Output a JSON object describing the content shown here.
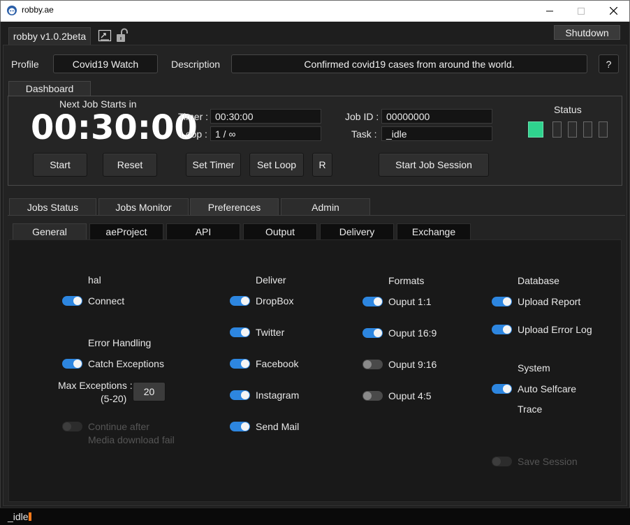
{
  "window": {
    "title": "robby.ae",
    "controls": [
      "minimize",
      "maximize",
      "close"
    ]
  },
  "header": {
    "version_tab": "robby v1.0.2beta",
    "shutdown_label": "Shutdown"
  },
  "profile": {
    "profile_label": "Profile",
    "profile_value": "Covid19 Watch",
    "description_label": "Description",
    "description_value": "Confirmed covid19 cases from around the world.",
    "help_label": "?"
  },
  "dashboard": {
    "tab_label": "Dashboard",
    "next_job_label": "Next Job Starts in",
    "countdown": "00:30:00",
    "timer_label": "Timer :",
    "timer_value": "00:30:00",
    "loop_label": "Loop :",
    "loop_value": "1 / ∞",
    "job_id_label": "Job ID :",
    "job_id_value": "00000000",
    "task_label": "Task  :",
    "task_value": "_idle",
    "status_label": "Status",
    "status_leds": [
      "active",
      "inactive",
      "inactive",
      "inactive",
      "inactive"
    ],
    "status_active_color": "#2fd38e",
    "buttons": {
      "start": "Start",
      "reset": "Reset",
      "set_timer": "Set Timer",
      "set_loop": "Set Loop",
      "r": "R",
      "start_session": "Start Job Session"
    }
  },
  "main_tabs": [
    {
      "label": "Jobs Status",
      "active": false
    },
    {
      "label": "Jobs Monitor",
      "active": false
    },
    {
      "label": "Preferences",
      "active": true
    },
    {
      "label": "Admin",
      "active": false
    }
  ],
  "sub_tabs": [
    {
      "label": "General",
      "active": true
    },
    {
      "label": "aeProject",
      "active": false
    },
    {
      "label": "API",
      "active": false
    },
    {
      "label": "Output",
      "active": false
    },
    {
      "label": "Delivery",
      "active": false
    },
    {
      "label": "Exchange",
      "active": false
    }
  ],
  "general": {
    "hal": {
      "heading": "hal",
      "connect": {
        "label": "Connect",
        "on": true
      }
    },
    "error_handling": {
      "heading": "Error Handling",
      "catch_exceptions": {
        "label": "Catch Exceptions",
        "on": true
      },
      "max_exceptions_label": "Max Exceptions :",
      "max_exceptions_range": "(5-20)",
      "max_exceptions_value": "20",
      "continue_after": {
        "label_line1": "Continue after",
        "label_line2": "Media download fail",
        "on": false,
        "disabled": true
      }
    },
    "deliver": {
      "heading": "Deliver",
      "items": [
        {
          "label": "DropBox",
          "on": true
        },
        {
          "label": "Twitter",
          "on": true
        },
        {
          "label": "Facebook",
          "on": true
        },
        {
          "label": "Instagram",
          "on": true
        },
        {
          "label": "Send Mail",
          "on": true
        }
      ]
    },
    "formats": {
      "heading": "Formats",
      "items": [
        {
          "label": "Ouput 1:1",
          "on": true
        },
        {
          "label": "Ouput 16:9",
          "on": true
        },
        {
          "label": "Ouput 9:16",
          "on": false
        },
        {
          "label": "Ouput 4:5",
          "on": false
        }
      ]
    },
    "database": {
      "heading": "Database",
      "items": [
        {
          "label": "Upload Report",
          "on": true
        },
        {
          "label": "Upload Error Log",
          "on": true
        }
      ]
    },
    "system": {
      "heading": "System",
      "auto_selfcare": {
        "label": "Auto Selfcare",
        "on": true
      },
      "trace_label": "Trace",
      "save_session": {
        "label": "Save Session",
        "on": false,
        "disabled": true
      }
    }
  },
  "status_bar": {
    "text": "_idle",
    "caret_color": "#ff7a1a"
  },
  "colors": {
    "accent": "#2d86e0",
    "background": "#1e1e1e",
    "led_active": "#2fd38e"
  }
}
